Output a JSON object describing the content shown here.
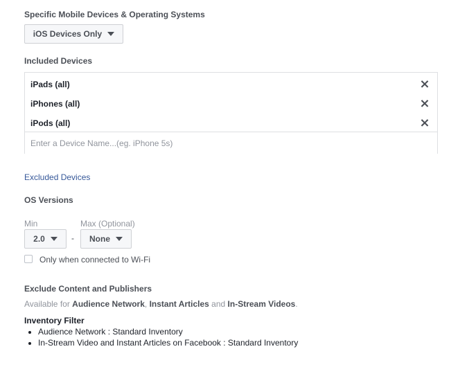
{
  "devices_section": {
    "title": "Specific Mobile Devices & Operating Systems",
    "dropdown_value": "iOS Devices Only"
  },
  "included_devices": {
    "title": "Included Devices",
    "items": [
      {
        "label": "iPads (all)"
      },
      {
        "label": "iPhones (all)"
      },
      {
        "label": "iPods (all)"
      }
    ],
    "remove_glyph": "×",
    "input_placeholder": "Enter a Device Name...(eg. iPhone 5s)"
  },
  "excluded_devices_link": "Excluded Devices",
  "os_versions": {
    "title": "OS Versions",
    "min_label": "Min",
    "max_label": "Max (Optional)",
    "min_value": "2.0",
    "separator": "-",
    "max_value": "None"
  },
  "wifi_option": {
    "label": "Only when connected to Wi-Fi",
    "checked": false
  },
  "exclude_content": {
    "title": "Exclude Content and Publishers",
    "available_prefix": "Available for",
    "network": "Audience Network",
    "sep1": ",",
    "articles": "Instant Articles",
    "and_text": "and",
    "videos": "In-Stream Videos",
    "period": "."
  },
  "inventory_filter": {
    "title": "Inventory Filter",
    "items": [
      "Audience Network : Standard Inventory",
      "In-Stream Video and Instant Articles on Facebook : Standard Inventory"
    ]
  },
  "colors": {
    "link": "#365899",
    "border": "#dddfe2",
    "muted": "#90949c"
  }
}
